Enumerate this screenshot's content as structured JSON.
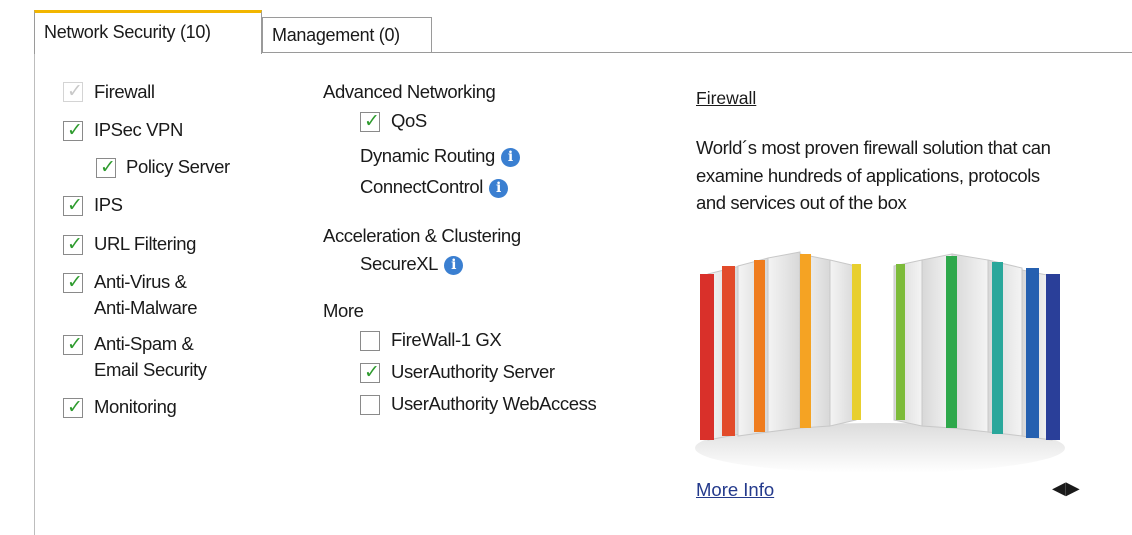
{
  "tabs": [
    {
      "label": "Network Security (10)",
      "active": true
    },
    {
      "label": "Management (0)",
      "active": false
    }
  ],
  "column1": [
    {
      "label": "Firewall",
      "checked": true,
      "disabled": true
    },
    {
      "label": "IPSec VPN",
      "checked": true
    },
    {
      "label": "Policy Server",
      "checked": true
    },
    {
      "label": "IPS",
      "checked": true
    },
    {
      "label": "URL Filtering",
      "checked": true
    },
    {
      "label_line1": "Anti-Virus &",
      "label_line2": "Anti-Malware",
      "checked": true
    },
    {
      "label_line1": "Anti-Spam &",
      "label_line2": "Email Security",
      "checked": true
    },
    {
      "label": "Monitoring",
      "checked": true
    }
  ],
  "column2": {
    "advanced_heading": "Advanced Networking",
    "qos": {
      "label": "QoS",
      "checked": true
    },
    "dynamic_routing": "Dynamic Routing",
    "connectcontrol": "ConnectControl",
    "accel_heading": "Acceleration & Clustering",
    "securexl": "SecureXL",
    "more_heading": "More",
    "firewall1gx": {
      "label": "FireWall-1 GX",
      "checked": false
    },
    "ua_server": {
      "label": "UserAuthority Server",
      "checked": true
    },
    "ua_webaccess": {
      "label": "UserAuthority WebAccess",
      "checked": false
    },
    "info_icon": "i"
  },
  "detail": {
    "title": "Firewall",
    "description": "World´s most proven firewall solution that can examine hundreds of applications, protocols and services out of the box",
    "more_info": "More Info",
    "nav_icon": "◀▶"
  },
  "check_glyph": "✓",
  "colors": {
    "accent_tab": "#f2b600",
    "check": "#2e9b2e",
    "info": "#3a7fd1",
    "link": "#243a8c"
  }
}
